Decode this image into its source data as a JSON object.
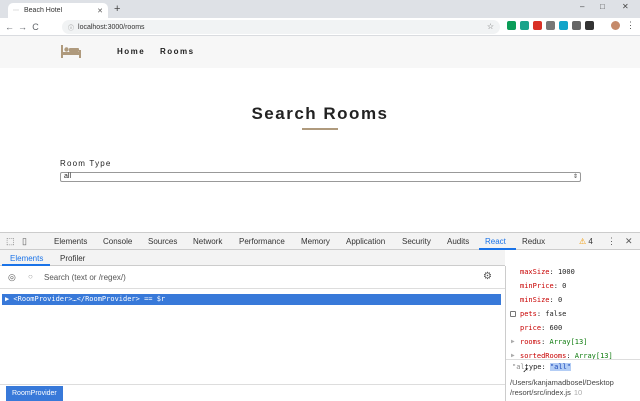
{
  "browser": {
    "tab_title": "Beach Hotel",
    "new_tab": "+",
    "url": "localhost:3000/rooms",
    "star": "☆",
    "back": "←",
    "forward": "→",
    "reload": "C",
    "window_controls": {
      "minimize": "–",
      "maximize": "□",
      "close": "✕"
    },
    "tab_close": "✕",
    "menu": "⋮",
    "extensions": [
      {
        "name": "ext-green-icon",
        "color": "#0b9d58"
      },
      {
        "name": "ext-teal-icon",
        "color": "#1aa38a"
      },
      {
        "name": "ext-red-icon",
        "color": "#d93025"
      },
      {
        "name": "ext-gray-icon",
        "color": "#777777"
      },
      {
        "name": "ext-cyan-icon",
        "color": "#12a4c9"
      },
      {
        "name": "ext-code-icon",
        "color": "#666666"
      },
      {
        "name": "ext-dark-icon",
        "color": "#333333"
      }
    ]
  },
  "site": {
    "nav": {
      "home": "Home",
      "rooms": "Rooms"
    },
    "title": "Search Rooms",
    "form": {
      "label": "Room Type",
      "selected": "all"
    },
    "accent_color": "#af9a7d"
  },
  "devtools": {
    "tabs": [
      "Elements",
      "Console",
      "Sources",
      "Network",
      "Performance",
      "Memory",
      "Application",
      "Security",
      "Audits",
      "React",
      "Redux"
    ],
    "active_tab": "React",
    "warnings": "4",
    "close": "✕",
    "menu": "⋮",
    "sub_tabs": [
      "Elements",
      "Profiler"
    ],
    "search_placeholder": "Search (text or /regex/)",
    "tree_row": "▶ <RoomProvider>…</RoomProvider> == $r",
    "breadcrumb": "RoomProvider",
    "props": [
      {
        "key": "maxSize",
        "value": "1000",
        "kind": "plain"
      },
      {
        "key": "minPrice",
        "value": "0",
        "kind": "plain"
      },
      {
        "key": "minSize",
        "value": "0",
        "kind": "plain"
      },
      {
        "key": "pets",
        "value": "false",
        "kind": "checkbox"
      },
      {
        "key": "price",
        "value": "600",
        "kind": "plain"
      },
      {
        "key": "rooms",
        "value": "Array[13]",
        "kind": "array"
      },
      {
        "key": "sortedRooms",
        "value": "Array[13]",
        "kind": "array"
      }
    ],
    "console": {
      "prefix": "\"al",
      "key": "type: ",
      "value": "\"all\""
    },
    "file_path": [
      "/Users/kanjamadbosel/Desktop",
      "/resort/src/index.js"
    ],
    "line_no": "10"
  }
}
